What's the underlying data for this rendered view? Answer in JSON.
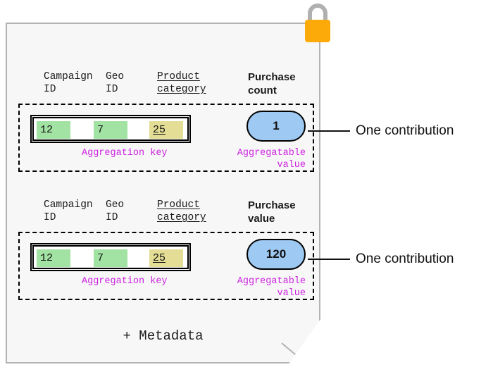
{
  "document": {
    "card_label": "encrypted-report-card",
    "lock_icon": "padlock-icon",
    "metadata_footer": "+ Metadata",
    "card_fill": "#f7f7f7",
    "card_border": "#b3b3b3",
    "lock_body_color": "#fbaa09",
    "lock_shackle_color": "#b0b0b0"
  },
  "colors": {
    "key_cell_green": "#a2e2a2",
    "key_cell_yellow": "#e3dd95",
    "value_bubble_blue": "#9ec9f2",
    "annotation_purple": "#cc22e0",
    "outline_black": "#000000"
  },
  "annotations": {
    "aggregation_key": "Aggregation key",
    "aggregatable_value": "Aggregatable\nvalue"
  },
  "callouts": [
    {
      "label": "One contribution"
    },
    {
      "label": "One contribution"
    }
  ],
  "contributions": [
    {
      "id": "contribution-1",
      "headers": {
        "campaign": "Campaign\nID",
        "geo": "Geo\nID",
        "product": "Product\ncategory",
        "value": "Purchase\ncount"
      },
      "key_cells": {
        "campaign": "12",
        "geo": "7",
        "product": "25"
      },
      "value": "1"
    },
    {
      "id": "contribution-2",
      "headers": {
        "campaign": "Campaign\nID",
        "geo": "Geo\nID",
        "product": "Product\ncategory",
        "value": "Purchase\nvalue"
      },
      "key_cells": {
        "campaign": "12",
        "geo": "7",
        "product": "25"
      },
      "value": "120"
    }
  ]
}
